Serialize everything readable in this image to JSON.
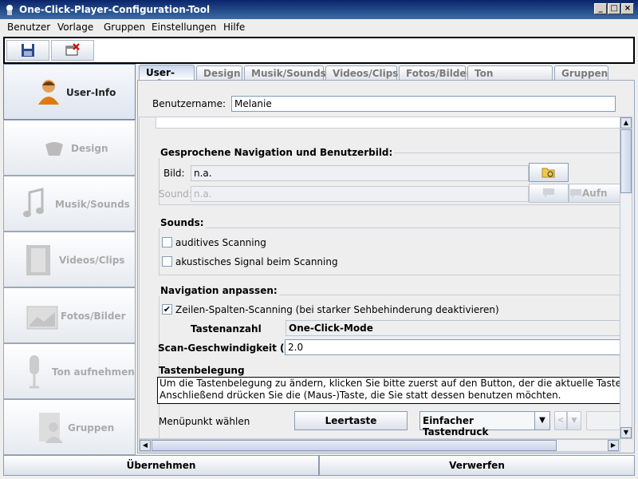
{
  "window": {
    "title": "One-Click-Player-Configuration-Tool"
  },
  "menu": [
    "Benutzer",
    "Vorlage",
    "Gruppen",
    "Einstellungen",
    "Hilfe"
  ],
  "toolbar": {
    "save_icon": "floppy-disk-icon",
    "close_icon": "close-window-icon"
  },
  "sidebar": [
    {
      "label": "User-Info",
      "icon": "user-icon"
    },
    {
      "label": "Design",
      "icon": "design-icon"
    },
    {
      "label": "Musik/Sounds",
      "icon": "music-note-icon"
    },
    {
      "label": "Videos/Clips",
      "icon": "film-icon"
    },
    {
      "label": "Fotos/Bilder",
      "icon": "photo-icon"
    },
    {
      "label": "Ton aufnehmen",
      "icon": "microphone-icon"
    },
    {
      "label": "Gruppen",
      "icon": "group-icon"
    }
  ],
  "tabs": [
    "User-Info",
    "Design",
    "Musik/Sounds",
    "Videos/Clips",
    "Fotos/Bilder",
    "Ton aufnehmen",
    "Gruppen"
  ],
  "user": {
    "name_label": "Benutzername:",
    "name_value": "Melanie"
  },
  "nav_section": {
    "title": "Gesprochene Navigation und Benutzerbild:",
    "bild_label": "Bild:",
    "bild_value": "n.a.",
    "sound_label": "Sound:",
    "sound_value": "n.a.",
    "record_label": "Aufn"
  },
  "sounds_section": {
    "title": "Sounds:",
    "opt1": "auditives Scanning",
    "opt2": "akustisches Signal beim Scanning"
  },
  "navigation_section": {
    "title": "Navigation anpassen:",
    "check_label": "Zeilen-Spalten-Scanning (bei starker Sehbehinderung deaktivieren)",
    "keys_label": "Tastenanzahl",
    "keys_value": "One-Click-Mode",
    "speed_label": "Scan-Geschwindigkeit (sec)",
    "speed_value": "2.0",
    "mapping_title": "Tastenbelegung",
    "mapping_line1": "Um die Tastenbelegung zu ändern, klicken Sie bitte zuerst auf den Button, der die aktuelle Tastenbelegung",
    "mapping_line2": "Anschließend drücken Sie die (Maus-)Taste, die Sie statt dessen benutzen möchten.",
    "menu_label": "Menüpunkt wählen",
    "key_button": "Leertaste",
    "press_type": "Einfacher Tastendruck"
  },
  "footer": {
    "apply": "Übernehmen",
    "discard": "Verwerfen"
  }
}
